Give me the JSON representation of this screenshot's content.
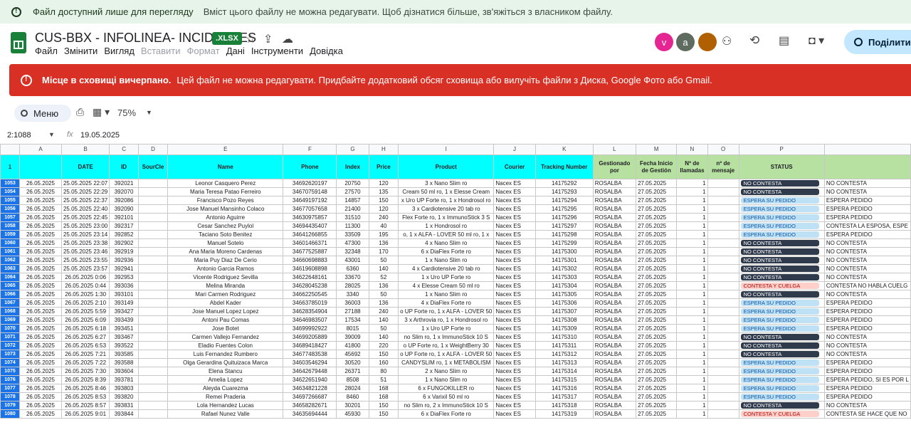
{
  "notice": {
    "title": "Файл доступний лише для перегляду",
    "text": "Вміст цього файлу не можна редагувати. Щоб дізнатися більше, зв'яжіться з власником файлу."
  },
  "doc": {
    "title": "CUS-BBX - INFOLINEA- INCIDENTES",
    "badge": ".XLSX"
  },
  "menu": [
    {
      "label": "Файл",
      "enabled": true
    },
    {
      "label": "Змінити",
      "enabled": true
    },
    {
      "label": "Вигляд",
      "enabled": true
    },
    {
      "label": "Вставити",
      "enabled": false
    },
    {
      "label": "Формат",
      "enabled": false
    },
    {
      "label": "Дані",
      "enabled": true
    },
    {
      "label": "Інструменти",
      "enabled": true
    },
    {
      "label": "Довідка",
      "enabled": true
    }
  ],
  "avatars": [
    {
      "letter": "v",
      "color": "#e52592"
    },
    {
      "letter": "a",
      "color": "#5f6b5f"
    },
    {
      "letter": "",
      "color": "#b06000"
    }
  ],
  "share_label": "Поділитися",
  "storage_error": {
    "bold": "Місце в сховищі вичерпано.",
    "text": "Цей файл не можна редагувати. Придбайте додатковий обсяг сховища або вилучіть файли з Диска, Google Фото або Gmail."
  },
  "toolbar": {
    "search_label": "Меню",
    "zoom": "75%"
  },
  "formula_bar": {
    "name_box": "2:1088",
    "value": "19.05.2025"
  },
  "columns": [
    "A",
    "B",
    "C",
    "D",
    "E",
    "F",
    "G",
    "H",
    "I",
    "J",
    "K",
    "L",
    "M",
    "N",
    "O",
    "P",
    ""
  ],
  "headers": [
    "",
    "DATE",
    "ID",
    "SourCIe",
    "Name",
    "Phone",
    "Index",
    "Price",
    "Product",
    "Courier",
    "Tracking Number",
    "Gestionado por",
    "Fecha Inicio de Gestión",
    "Nº de llamadas",
    "nº de mensaje",
    "STATUS",
    ""
  ],
  "status_colors": {
    "NO CONTESTA": {
      "bg": "#2f3b4c",
      "fg": "#ffffff"
    },
    "ESPERA SU PEDIDO": {
      "bg": "#bfe1f6",
      "fg": "#0a53a8"
    },
    "CONTESTA Y CUELGA": {
      "bg": "#ffcfc9",
      "fg": "#b10202"
    }
  },
  "rows": [
    {
      "n": "1053",
      "a": "26.05.2025",
      "date": "25.05.2025 22:07",
      "id": "392021",
      "name": "Leonor Casquero Perez",
      "phone": "34692620197",
      "index": "20750",
      "price": "120",
      "product": "3 x Nano Slim ro",
      "courier": "Nacex ES",
      "track": "14175292",
      "gest": "ROSALBA",
      "fecha": "27.05.2025",
      "calls": "1",
      "status": "NO CONTESTA",
      "note": "NO CONTESTA"
    },
    {
      "n": "1054",
      "a": "26.05.2025",
      "date": "25.05.2025 22:29",
      "id": "392070",
      "name": "Maria Teresa Patao Ferreiro",
      "phone": "34670759148",
      "index": "27570",
      "price": "135",
      "product": "Cream 50 ml ro, 1 x Elesse Cream",
      "courier": "Nacex ES",
      "track": "14175293",
      "gest": "ROSALBA",
      "fecha": "27.05.2025",
      "calls": "1",
      "status": "NO CONTESTA",
      "note": "NO CONTESTA"
    },
    {
      "n": "1055",
      "a": "26.05.2025",
      "date": "25.05.2025 22:37",
      "id": "392086",
      "name": "Francisco Pozo Reyes",
      "phone": "34649197192",
      "index": "14857",
      "price": "150",
      "product": "x Uro UP Forte ro, 1 x Hondrosol ro",
      "courier": "Nacex ES",
      "track": "14175294",
      "gest": "ROSALBA",
      "fecha": "27.05.2025",
      "calls": "1",
      "status": "ESPERA SU PEDIDO",
      "note": "ESPERA PEDIDO"
    },
    {
      "n": "1056",
      "a": "26.05.2025",
      "date": "25.05.2025 22:40",
      "id": "392090",
      "name": "Jose Manuel Mansinho Colaco",
      "phone": "34677057658",
      "index": "21400",
      "price": "120",
      "product": "3 x Cardiotensive 20 tab ro",
      "courier": "Nacex ES",
      "track": "14175295",
      "gest": "ROSALBA",
      "fecha": "27.05.2025",
      "calls": "1",
      "status": "ESPERA SU PEDIDO",
      "note": "ESPERA PEDIDO"
    },
    {
      "n": "1057",
      "a": "26.05.2025",
      "date": "25.05.2025 22:45",
      "id": "392101",
      "name": "Antonio Aguirre",
      "phone": "34630975857",
      "index": "31510",
      "price": "240",
      "product": "Flex Forte ro, 1 x ImmunoStick 3 S",
      "courier": "Nacex ES",
      "track": "14175296",
      "gest": "ROSALBA",
      "fecha": "27.05.2025",
      "calls": "1",
      "status": "ESPERA SU PEDIDO",
      "note": "ESPERA PEDIDO"
    },
    {
      "n": "1058",
      "a": "26.05.2025",
      "date": "25.05.2025 23:00",
      "id": "392317",
      "name": "Cesar Sanchez Puylol",
      "phone": "34694435407",
      "index": "11300",
      "price": "40",
      "product": "1 x Hondrosol ro",
      "courier": "Nacex ES",
      "track": "14175297",
      "gest": "ROSALBA",
      "fecha": "27.05.2025",
      "calls": "1",
      "status": "ESPERA SU PEDIDO",
      "note": "CONTESTA LA ESPOSA, ESPE"
    },
    {
      "n": "1059",
      "a": "26.05.2025",
      "date": "25.05.2025 23:14",
      "id": "392852",
      "name": "Taciano Soto Benitez",
      "phone": "34641266855",
      "index": "33509",
      "price": "195",
      "product": "o, 1 x ALFA - LOVER 50 ml ro, 1 x",
      "courier": "Nacex ES",
      "track": "14175298",
      "gest": "ROSALBA",
      "fecha": "27.05.2025",
      "calls": "1",
      "status": "ESPERA SU PEDIDO",
      "note": "ESPERA PEDIDO"
    },
    {
      "n": "1060",
      "a": "26.05.2025",
      "date": "25.05.2025 23:38",
      "id": "392902",
      "name": "Manuel Sotelo",
      "phone": "34601466371",
      "index": "47300",
      "price": "136",
      "product": "4 x Nano Slim ro",
      "courier": "Nacex ES",
      "track": "14175299",
      "gest": "ROSALBA",
      "fecha": "27.05.2025",
      "calls": "1",
      "status": "NO CONTESTA",
      "note": "NO CONTESTA"
    },
    {
      "n": "1061",
      "a": "26.05.2025",
      "date": "25.05.2025 23:46",
      "id": "392919",
      "name": "Ana Maria Moreno Cardenas",
      "phone": "34677525887",
      "index": "32348",
      "price": "170",
      "product": "6 x DiaFlex Forte ro",
      "courier": "Nacex ES",
      "track": "14175300",
      "gest": "ROSALBA",
      "fecha": "27.05.2025",
      "calls": "1",
      "status": "NO CONTESTA",
      "note": "NO CONTESTA"
    },
    {
      "n": "1062",
      "a": "26.05.2025",
      "date": "25.05.2025 23:55",
      "id": "392936",
      "name": "Maria Puy Diaz De Cerio",
      "phone": "34660698883",
      "index": "43001",
      "price": "50",
      "product": "1 x Nano Slim ro",
      "courier": "Nacex ES",
      "track": "14175301",
      "gest": "ROSALBA",
      "fecha": "27.05.2025",
      "calls": "1",
      "status": "NO CONTESTA",
      "note": "NO CONTESTA"
    },
    {
      "n": "1063",
      "a": "26.05.2025",
      "date": "25.05.2025 23:57",
      "id": "392941",
      "name": "Antonio Garcia Ramos",
      "phone": "34619608898",
      "index": "6360",
      "price": "140",
      "product": "4 x Cardiotensive 20 tab ro",
      "courier": "Nacex ES",
      "track": "14175302",
      "gest": "ROSALBA",
      "fecha": "27.05.2025",
      "calls": "1",
      "status": "NO CONTESTA",
      "note": "NO CONTESTA"
    },
    {
      "n": "1064",
      "a": "26.05.2025",
      "date": "26.05.2025 0:06",
      "id": "392953",
      "name": "Vicente Rodriguez Sevilla",
      "phone": "34622648161",
      "index": "33670",
      "price": "52",
      "product": "1 x Uro UP Forte ro",
      "courier": "Nacex ES",
      "track": "14175303",
      "gest": "ROSALBA",
      "fecha": "27.05.2025",
      "calls": "1",
      "status": "NO CONTESTA",
      "note": "NO CONTESTA"
    },
    {
      "n": "1065",
      "a": "26.05.2025",
      "date": "26.05.2025 0:44",
      "id": "393036",
      "name": "Melina Miranda",
      "phone": "34628045238",
      "index": "28025",
      "price": "136",
      "product": "4 x Elesse Cream 50 ml ro",
      "courier": "Nacex ES",
      "track": "14175304",
      "gest": "ROSALBA",
      "fecha": "27.05.2025",
      "calls": "1",
      "status": "CONTESTA Y CUELGA",
      "note": "CONTESTA NO HABLA CUELG"
    },
    {
      "n": "1066",
      "a": "26.05.2025",
      "date": "26.05.2025 1:30",
      "id": "393101",
      "name": "Mari Carmen Rodriguez",
      "phone": "34662250545",
      "index": "3340",
      "price": "50",
      "product": "1 x Nano Slim ro",
      "courier": "Nacex ES",
      "track": "14175305",
      "gest": "ROSALBA",
      "fecha": "27.05.2025",
      "calls": "1",
      "status": "NO CONTESTA",
      "note": "NO CONTESTA"
    },
    {
      "n": "1067",
      "a": "26.05.2025",
      "date": "26.05.2025 2:10",
      "id": "393149",
      "name": "Abdel Kader",
      "phone": "34663785019",
      "index": "36003",
      "price": "136",
      "product": "4 x DiaFlex Forte ro",
      "courier": "Nacex ES",
      "track": "14175306",
      "gest": "ROSALBA",
      "fecha": "27.05.2025",
      "calls": "1",
      "status": "ESPERA SU PEDIDO",
      "note": "ESPERA PEDIDO"
    },
    {
      "n": "1068",
      "a": "26.05.2025",
      "date": "26.05.2025 5:59",
      "id": "393427",
      "name": "Jose Manuel Lopez Lopez",
      "phone": "34628354904",
      "index": "27188",
      "price": "240",
      "product": "o UP Forte ro, 1 x ALFA - LOVER 50",
      "courier": "Nacex ES",
      "track": "14175307",
      "gest": "ROSALBA",
      "fecha": "27.05.2025",
      "calls": "1",
      "status": "ESPERA SU PEDIDO",
      "note": "ESPERA PEDIDO"
    },
    {
      "n": "1069",
      "a": "26.05.2025",
      "date": "26.05.2025 6:09",
      "id": "393439",
      "name": "Antoni Pau Comas",
      "phone": "34646983507",
      "index": "17534",
      "price": "140",
      "product": "3 x Arthrovia ro, 1 x Hondrosol ro",
      "courier": "Nacex ES",
      "track": "14175308",
      "gest": "ROSALBA",
      "fecha": "27.05.2025",
      "calls": "1",
      "status": "ESPERA SU PEDIDO",
      "note": "ESPERA PEDIDO"
    },
    {
      "n": "1070",
      "a": "26.05.2025",
      "date": "26.05.2025 6:18",
      "id": "393451",
      "name": "Jose Botet",
      "phone": "34699992922",
      "index": "8015",
      "price": "50",
      "product": "1 x Uro UP Forte ro",
      "courier": "Nacex ES",
      "track": "14175309",
      "gest": "ROSALBA",
      "fecha": "27.05.2025",
      "calls": "1",
      "status": "ESPERA SU PEDIDO",
      "note": "ESPERA PEDIDO"
    },
    {
      "n": "1071",
      "a": "26.05.2025",
      "date": "26.05.2025 6:27",
      "id": "393467",
      "name": "Carmen Vallejo Fernandez",
      "phone": "34699205889",
      "index": "39009",
      "price": "140",
      "product": "no Slim ro, 1 x ImmunoStick 10 S",
      "courier": "Nacex ES",
      "track": "14175310",
      "gest": "ROSALBA",
      "fecha": "27.05.2025",
      "calls": "1",
      "status": "NO CONTESTA",
      "note": "NO CONTESTA"
    },
    {
      "n": "1072",
      "a": "26.05.2025",
      "date": "26.05.2025 6:53",
      "id": "393522",
      "name": "Eladio Fuentes Colon",
      "phone": "34689418427",
      "index": "41800",
      "price": "220",
      "product": "o UP Forte ro, 1 x WeightBerry 30",
      "courier": "Nacex ES",
      "track": "14175311",
      "gest": "ROSALBA",
      "fecha": "27.05.2025",
      "calls": "1",
      "status": "NO CONTESTA",
      "note": "NO CONTESTA"
    },
    {
      "n": "1073",
      "a": "26.05.2025",
      "date": "26.05.2025 7:21",
      "id": "393585",
      "name": "Luis Fernandez Rumbero",
      "phone": "34677483538",
      "index": "45692",
      "price": "150",
      "product": "o UP Forte ro, 1 x ALFA - LOVER 50",
      "courier": "Nacex ES",
      "track": "14175312",
      "gest": "ROSALBA",
      "fecha": "27.05.2025",
      "calls": "1",
      "status": "NO CONTESTA",
      "note": "NO CONTESTA"
    },
    {
      "n": "1074",
      "a": "26.05.2025",
      "date": "26.05.2025 7:22",
      "id": "393588",
      "name": "Olga Gerardina Quituizaca Marca",
      "phone": "34603546294",
      "index": "30520",
      "price": "160",
      "product": "CANDYSLIM ro, 1 x METABOLISM",
      "courier": "Nacex ES",
      "track": "14175313",
      "gest": "ROSALBA",
      "fecha": "27.05.2025",
      "calls": "1",
      "status": "ESPERA SU PEDIDO",
      "note": "ESPERA PEDIDO"
    },
    {
      "n": "1075",
      "a": "26.05.2025",
      "date": "26.05.2025 7:30",
      "id": "393604",
      "name": "Elena Stancu",
      "phone": "34642679448",
      "index": "26371",
      "price": "80",
      "product": "2 x Nano Slim ro",
      "courier": "Nacex ES",
      "track": "14175314",
      "gest": "ROSALBA",
      "fecha": "27.05.2025",
      "calls": "1",
      "status": "ESPERA SU PEDIDO",
      "note": "ESPERA PEDIDO"
    },
    {
      "n": "1076",
      "a": "26.05.2025",
      "date": "26.05.2025 8:39",
      "id": "393781",
      "name": "Amelia Lopez",
      "phone": "34622651940",
      "index": "8508",
      "price": "51",
      "product": "1 x Nano Slim ro",
      "courier": "Nacex ES",
      "track": "14175315",
      "gest": "ROSALBA",
      "fecha": "27.05.2025",
      "calls": "1",
      "status": "ESPERA SU PEDIDO",
      "note": "ESPERA PEDIDO, SI ES POR L"
    },
    {
      "n": "1077",
      "a": "26.05.2025",
      "date": "26.05.2025 8:46",
      "id": "393803",
      "name": "Aleyda Cuarezma",
      "phone": "34634821228",
      "index": "28024",
      "price": "168",
      "product": "6 x FUNGOKILLER ro",
      "courier": "Nacex ES",
      "track": "14175316",
      "gest": "ROSALBA",
      "fecha": "27.05.2025",
      "calls": "1",
      "status": "ESPERA SU PEDIDO",
      "note": "ESPERA PEDIDO"
    },
    {
      "n": "1078",
      "a": "26.05.2025",
      "date": "26.05.2025 8:53",
      "id": "393820",
      "name": "Remei Praderia",
      "phone": "34697266687",
      "index": "8460",
      "price": "168",
      "product": "6 x Varixil 50 ml ro",
      "courier": "Nacex ES",
      "track": "14175317",
      "gest": "ROSALBA",
      "fecha": "27.05.2025",
      "calls": "1",
      "status": "ESPERA SU PEDIDO",
      "note": "ESPERA PEDIDO"
    },
    {
      "n": "1079",
      "a": "26.05.2025",
      "date": "26.05.2025 8:57",
      "id": "393831",
      "name": "Lola Hernandez Lucas",
      "phone": "34658282671",
      "index": "30201",
      "price": "150",
      "product": "no Slim ro, 2 x ImmunoStick 10 S",
      "courier": "Nacex ES",
      "track": "14175318",
      "gest": "ROSALBA",
      "fecha": "27.05.2025",
      "calls": "1",
      "status": "NO CONTESTA",
      "note": "NO CONTESTA"
    },
    {
      "n": "1080",
      "a": "26.05.2025",
      "date": "26.05.2025 9:01",
      "id": "393844",
      "name": "Rafael Nunez Valle",
      "phone": "34635694444",
      "index": "45930",
      "price": "150",
      "product": "6 x DiaFlex Forte ro",
      "courier": "Nacex ES",
      "track": "14175319",
      "gest": "ROSALBA",
      "fecha": "27.05.2025",
      "calls": "1",
      "status": "CONTESTA Y CUELGA",
      "note": "CONTESTA SE HACE QUE NO"
    }
  ]
}
